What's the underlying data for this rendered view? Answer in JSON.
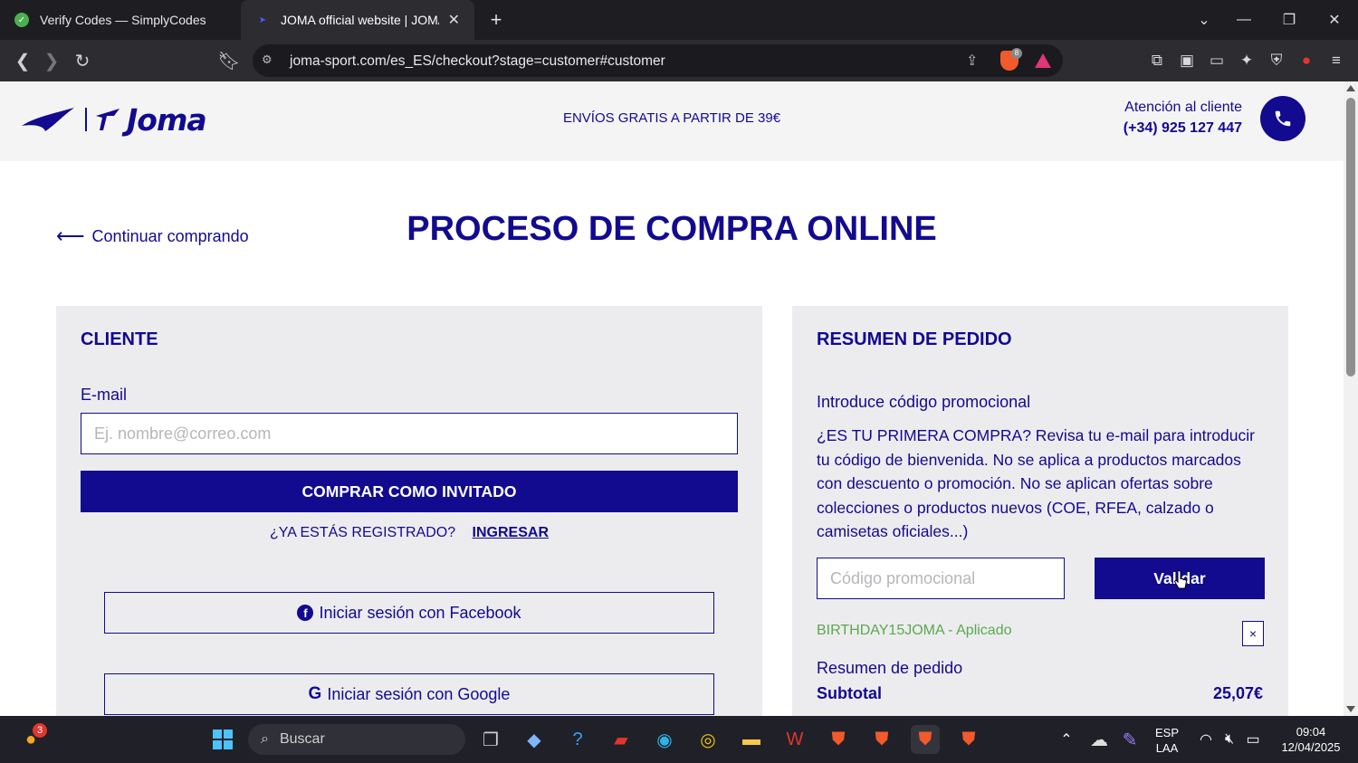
{
  "browser": {
    "tabs": [
      {
        "title": "Verify Codes — SimplyCodes",
        "active": false
      },
      {
        "title": "JOMA official website | JOMA ®",
        "active": true
      }
    ],
    "url": "joma-sport.com/es_ES/checkout?stage=customer#customer",
    "shields_count": "8"
  },
  "header": {
    "logo_text": "Joma",
    "shipping": "ENVÍOS GRATIS A PARTIR DE 39€",
    "support_label": "Atención al cliente",
    "support_phone": "(+34) 925 127 447"
  },
  "main": {
    "back_link": "Continuar comprando",
    "title": "PROCESO DE COMPRA ONLINE"
  },
  "customer": {
    "title": "CLIENTE",
    "email_label": "E-mail",
    "email_placeholder": "Ej. nombre@correo.com",
    "guest_button": "COMPRAR COMO INVITADO",
    "registered_prompt": "¿YA ESTÁS REGISTRADO?",
    "login_link": "INGRESAR",
    "facebook_button": "Iniciar sesión con Facebook",
    "google_button": "Iniciar sesión con Google"
  },
  "summary": {
    "title": "RESUMEN DE PEDIDO",
    "promo_label": "Introduce código promocional",
    "promo_text": "¿ES TU PRIMERA COMPRA? Revisa tu e-mail para introducir tu código de bienvenida. No se aplica a productos marcados con descuento o promoción. No se aplican ofertas sobre colecciones o productos nuevos (COE, RFEA, calzado o camisetas oficiales...)",
    "promo_placeholder": "Código promocional",
    "validate_button": "Validar",
    "applied_code": "BIRTHDAY15JOMA - Aplicado",
    "remove_label": "×",
    "summary_label": "Resumen de pedido",
    "subtotal_label": "Subtotal",
    "subtotal_value": "25,07€"
  },
  "taskbar": {
    "search_placeholder": "Buscar",
    "notification_count": "3",
    "lang_top": "ESP",
    "lang_bottom": "LAA",
    "time": "09:04",
    "date": "12/04/2025"
  },
  "colors": {
    "brand": "#120a8f",
    "applied": "#5ba94d"
  }
}
